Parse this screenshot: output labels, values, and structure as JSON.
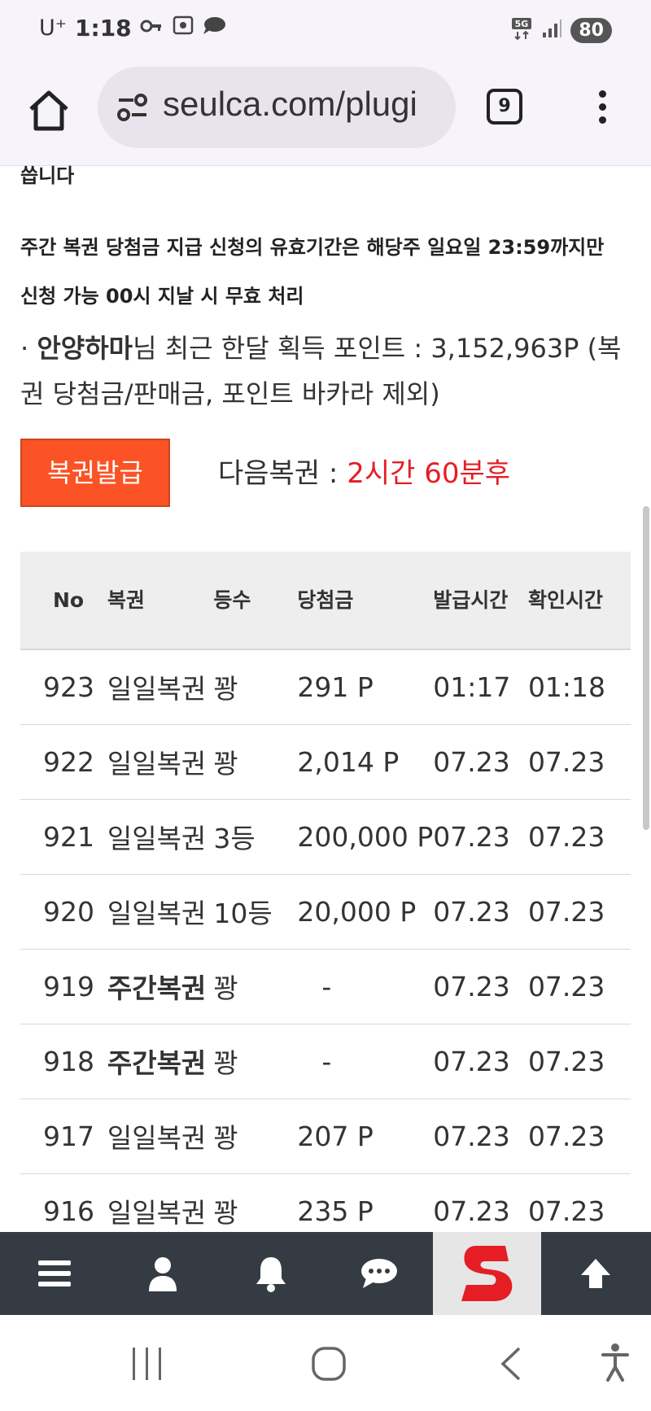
{
  "status_bar": {
    "carrier": "U⁺",
    "time": "1:18",
    "network": "5G",
    "battery": "80"
  },
  "browser": {
    "url": "seulca.com/plugi",
    "tab_count": "9"
  },
  "content": {
    "cut_text": "씁니다",
    "notice_line1": "주간 복권 당첨금 지급 신청의 유효기간은 해당주 일요일 23:59까지만",
    "notice_line2": "신청 가능 00시 지날 시 무효 처리",
    "points_bullet": "·",
    "nickname": "안양하마",
    "points_text": "님 최근 한달 획득 포인트 : 3,152,963P (복권 당첨금/판매금, 포인트 바카라 제외)",
    "issue_button": "복권발급",
    "next_label": "다음복권 : ",
    "next_remain": "2시간 60분후"
  },
  "table": {
    "headers": {
      "no": "No",
      "name": "복권",
      "rank": "등수",
      "prize": "당첨금",
      "issued": "발급시간",
      "checked": "확인시간"
    },
    "rows": [
      {
        "no": "923",
        "name": "일일복권",
        "rank": "꽝",
        "prize": "291 P",
        "issued": "01:17",
        "checked": "01:18"
      },
      {
        "no": "922",
        "name": "일일복권",
        "rank": "꽝",
        "prize": "2,014 P",
        "issued": "07.23",
        "checked": "07.23"
      },
      {
        "no": "921",
        "name": "일일복권",
        "rank": "3등",
        "prize": "200,000 P",
        "issued": "07.23",
        "checked": "07.23"
      },
      {
        "no": "920",
        "name": "일일복권",
        "rank": "10등",
        "prize": "20,000 P",
        "issued": "07.23",
        "checked": "07.23"
      },
      {
        "no": "919",
        "name": "주간복권",
        "rank": "꽝",
        "prize": "-",
        "issued": "07.23",
        "checked": "07.23"
      },
      {
        "no": "918",
        "name": "주간복권",
        "rank": "꽝",
        "prize": "-",
        "issued": "07.23",
        "checked": "07.23"
      },
      {
        "no": "917",
        "name": "일일복권",
        "rank": "꽝",
        "prize": "207 P",
        "issued": "07.23",
        "checked": "07.23"
      },
      {
        "no": "916",
        "name": "일일복권",
        "rank": "꽝",
        "prize": "235 P",
        "issued": "07.23",
        "checked": "07.23"
      }
    ]
  },
  "site_nav": {
    "icons": [
      "menu-icon",
      "user-icon",
      "bell-icon",
      "chat-icon",
      "site-logo-icon",
      "arrow-up-icon"
    ],
    "logo_letter": "S",
    "nav_color": "#343b43",
    "logo_color": "#e41e24"
  },
  "colors": {
    "accent": "#fb5325",
    "remain": "#e41e24"
  }
}
